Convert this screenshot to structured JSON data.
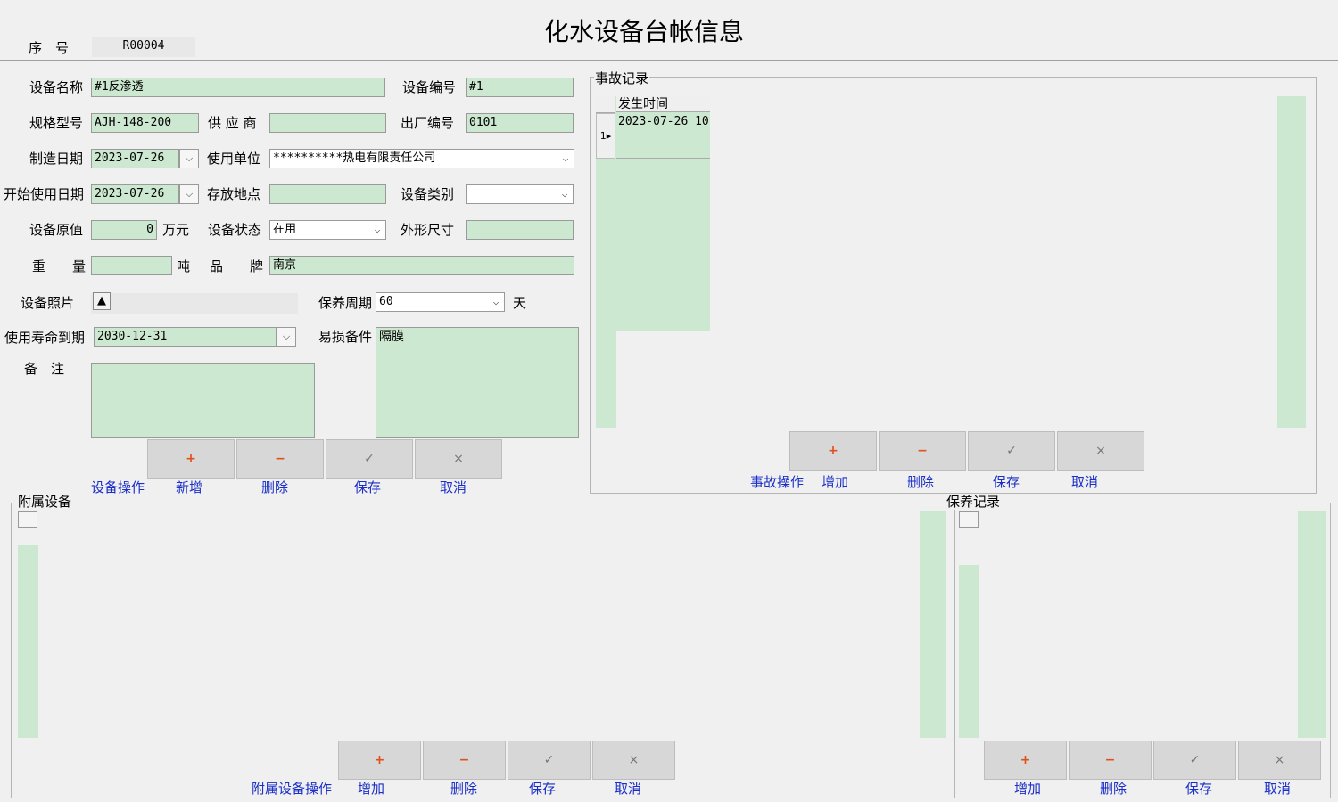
{
  "header": {
    "title": "化水设备台帐信息",
    "serial_label": "序　号",
    "serial_value": "R00004"
  },
  "form": {
    "device_name_label": "设备名称",
    "device_name": "#1反渗透",
    "device_no_label": "设备编号",
    "device_no": "#1",
    "spec_label": "规格型号",
    "spec": "AJH-148-200",
    "supplier_label": "供 应 商",
    "supplier": "",
    "factory_no_label": "出厂编号",
    "factory_no": "0101",
    "mfg_date_label": "制造日期",
    "mfg_date": "2023-07-26",
    "unit_label": "使用单位",
    "unit": "**********热电有限责任公司",
    "start_date_label": "开始使用日期",
    "start_date": "2023-07-26",
    "location_label": "存放地点",
    "location": "",
    "category_label": "设备类别",
    "category": "",
    "orig_value_label": "设备原值",
    "orig_value": "0",
    "orig_value_unit": "万元",
    "status_label": "设备状态",
    "status": "在用",
    "dimension_label": "外形尺寸",
    "dimension": "",
    "weight_label": "重　　量",
    "weight": "",
    "weight_unit": "吨",
    "brand_label": "品　　牌",
    "brand": "南京",
    "photo_label": "设备照片",
    "maintain_cycle_label": "保养周期",
    "maintain_cycle": "60",
    "maintain_cycle_unit": "天",
    "expiry_label": "使用寿命到期",
    "expiry": "2030-12-31",
    "spare_parts_label": "易损备件",
    "spare_parts": "隔膜",
    "remark_label": "备　注",
    "remark": ""
  },
  "device_ops": {
    "caption": "设备操作",
    "buttons": [
      {
        "glyph": "+",
        "label": "新增"
      },
      {
        "glyph": "−",
        "label": "删除"
      },
      {
        "glyph": "✓",
        "label": "保存"
      },
      {
        "glyph": "×",
        "label": "取消"
      }
    ]
  },
  "accident": {
    "title": "事故记录",
    "columns": [
      "发生时间"
    ],
    "rows": [
      {
        "row_no": "1",
        "time": "2023-07-26 10"
      }
    ],
    "caption": "事故操作",
    "buttons": [
      {
        "glyph": "+",
        "label": "增加"
      },
      {
        "glyph": "−",
        "label": "删除"
      },
      {
        "glyph": "✓",
        "label": "保存"
      },
      {
        "glyph": "×",
        "label": "取消"
      }
    ]
  },
  "attached": {
    "title": "附属设备",
    "caption": "附属设备操作",
    "buttons": [
      {
        "glyph": "+",
        "label": "增加"
      },
      {
        "glyph": "−",
        "label": "删除"
      },
      {
        "glyph": "✓",
        "label": "保存"
      },
      {
        "glyph": "×",
        "label": "取消"
      }
    ]
  },
  "maintenance": {
    "title": "保养记录",
    "buttons": [
      {
        "glyph": "+",
        "label": "增加"
      },
      {
        "glyph": "−",
        "label": "删除"
      },
      {
        "glyph": "✓",
        "label": "保存"
      },
      {
        "glyph": "×",
        "label": "取消"
      }
    ]
  },
  "colors": {
    "field_bg": "#cde8d0",
    "link_blue": "#1a2ec8",
    "active_glyph": "#e0501a"
  }
}
